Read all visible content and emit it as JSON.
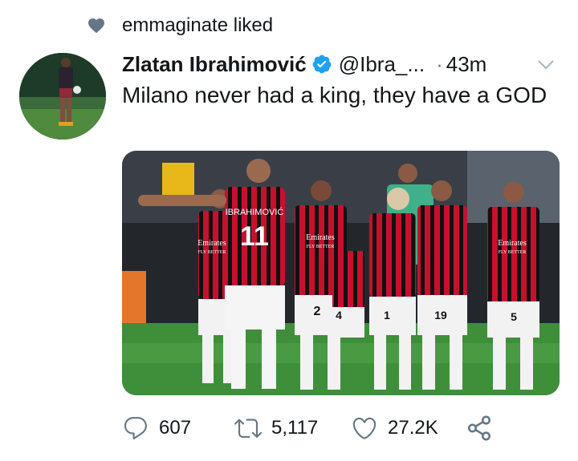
{
  "social_context": {
    "text": "emmaginate liked",
    "icon": "heart-icon"
  },
  "tweet": {
    "author_name": "Zlatan Ibrahimović",
    "author_handle": "@Ibra_...",
    "separator": "·",
    "time": "43m",
    "text": "Milano never had a king, they have a GOD",
    "verified": true,
    "image": {
      "jersey_name": "IBRAHIMOVIĆ",
      "jersey_number": "11",
      "sponsor_line1": "Emirates",
      "sponsor_line2": "FLY BETTER",
      "other_numbers": [
        "2",
        "4",
        "1",
        "19",
        "5"
      ]
    }
  },
  "actions": {
    "replies": "607",
    "retweets": "5,117",
    "likes": "27.2K"
  },
  "colors": {
    "verified_blue": "#1da1f2",
    "icon_gray": "#657786",
    "milan_red": "#c8102e",
    "pitch_green": "#3f8f3a"
  }
}
